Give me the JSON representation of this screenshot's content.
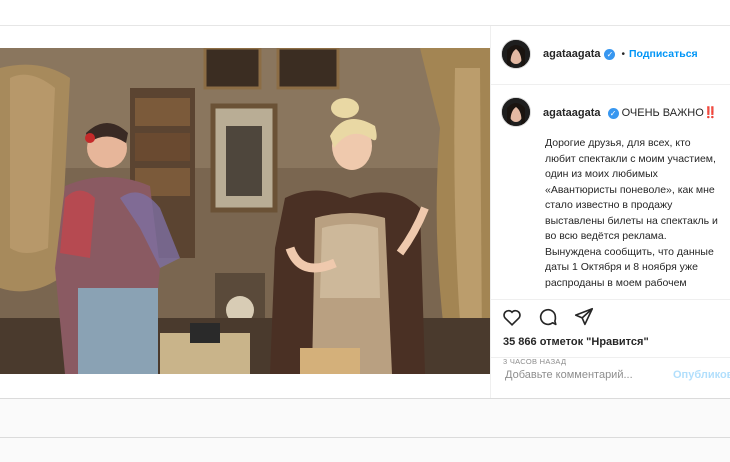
{
  "post": {
    "username": "agataagata",
    "follow_label": "Подписаться",
    "dot": "•",
    "caption_title": "ОЧЕНЬ ВАЖНО‼️",
    "caption_body": [
      "Дорогие друзья, для всех, кто",
      "любит спектакли с моим участием,",
      "один из моих любимых",
      "«Авантюристы поневоле», как мне",
      "стало известно в продажу",
      "выставлены билеты на спектакль и",
      "во всю ведётся реклама.",
      "Вынуждена сообщить, что данные",
      "даты 1 Октября и 8 ноября уже",
      "распроданы в моем рабочем"
    ],
    "likes": "35 866 отметок \"Нравится\"",
    "time": "3 ЧАСОВ НАЗАД",
    "comment_placeholder": "Добавьте комментарий...",
    "publish_label": "Опубликовать"
  },
  "icons": [
    "heart-icon",
    "comment-icon",
    "share-icon"
  ],
  "colors": {
    "link": "#0095f6",
    "verified": "#3897f0",
    "border": "#dbdbdb"
  }
}
